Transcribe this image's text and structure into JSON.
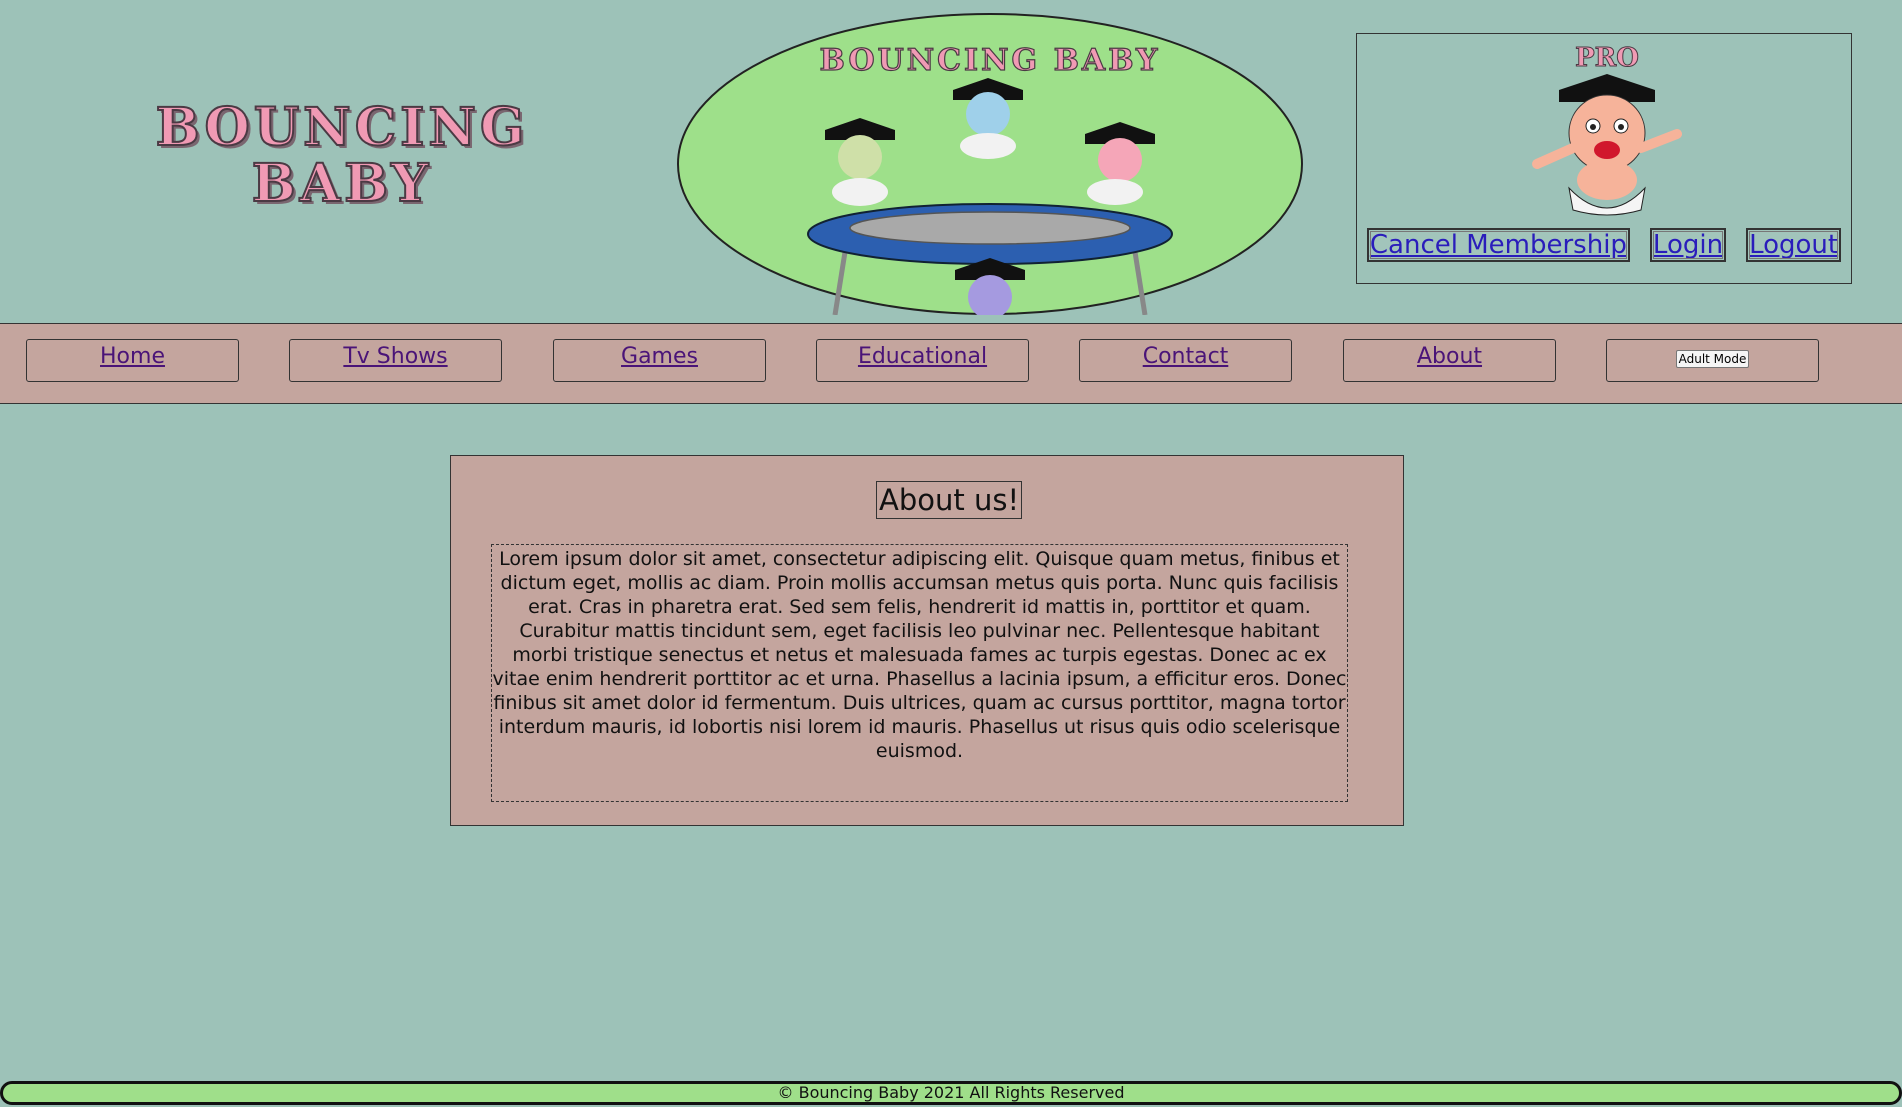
{
  "header": {
    "site_title": "BOUNCING BABY",
    "logo_banner_text": "BOUNCING BABY",
    "pro_label": "PRO"
  },
  "auth": {
    "cancel_label": "Cancel Membership",
    "login_label": "Login",
    "logout_label": "Logout"
  },
  "nav": {
    "items": [
      "Home",
      "Tv Shows",
      "Games",
      "Educational",
      "Contact",
      "About"
    ],
    "adult_mode_label": "Adult Mode"
  },
  "main": {
    "title": "About us!",
    "body": "Lorem ipsum dolor sit amet, consectetur adipiscing elit. Quisque quam metus, finibus et dictum eget, mollis ac diam. Proin mollis accumsan metus quis porta. Nunc quis facilisis erat. Cras in pharetra erat. Sed sem felis, hendrerit id mattis in, porttitor et quam. Curabitur mattis tincidunt sem, eget facilisis leo pulvinar nec. Pellentesque habitant morbi tristique senectus et netus et malesuada fames ac turpis egestas. Donec ac ex vitae enim hendrerit porttitor ac et urna. Phasellus a lacinia ipsum, a efficitur eros. Donec finibus sit amet dolor id fermentum. Duis ultrices, quam ac cursus porttitor, magna tortor interdum mauris, id lobortis nisi lorem id mauris. Phasellus ut risus quis odio scelerisque euismod."
  },
  "footer": {
    "text": "© Bouncing Baby 2021 All Rights Reserved"
  },
  "colors": {
    "page_background": "#9dc2b8",
    "panel_background": "#c4a59e",
    "logo_circle": "#9ee08a",
    "footer_background": "#9fdf8a",
    "link": "#4a1478"
  }
}
